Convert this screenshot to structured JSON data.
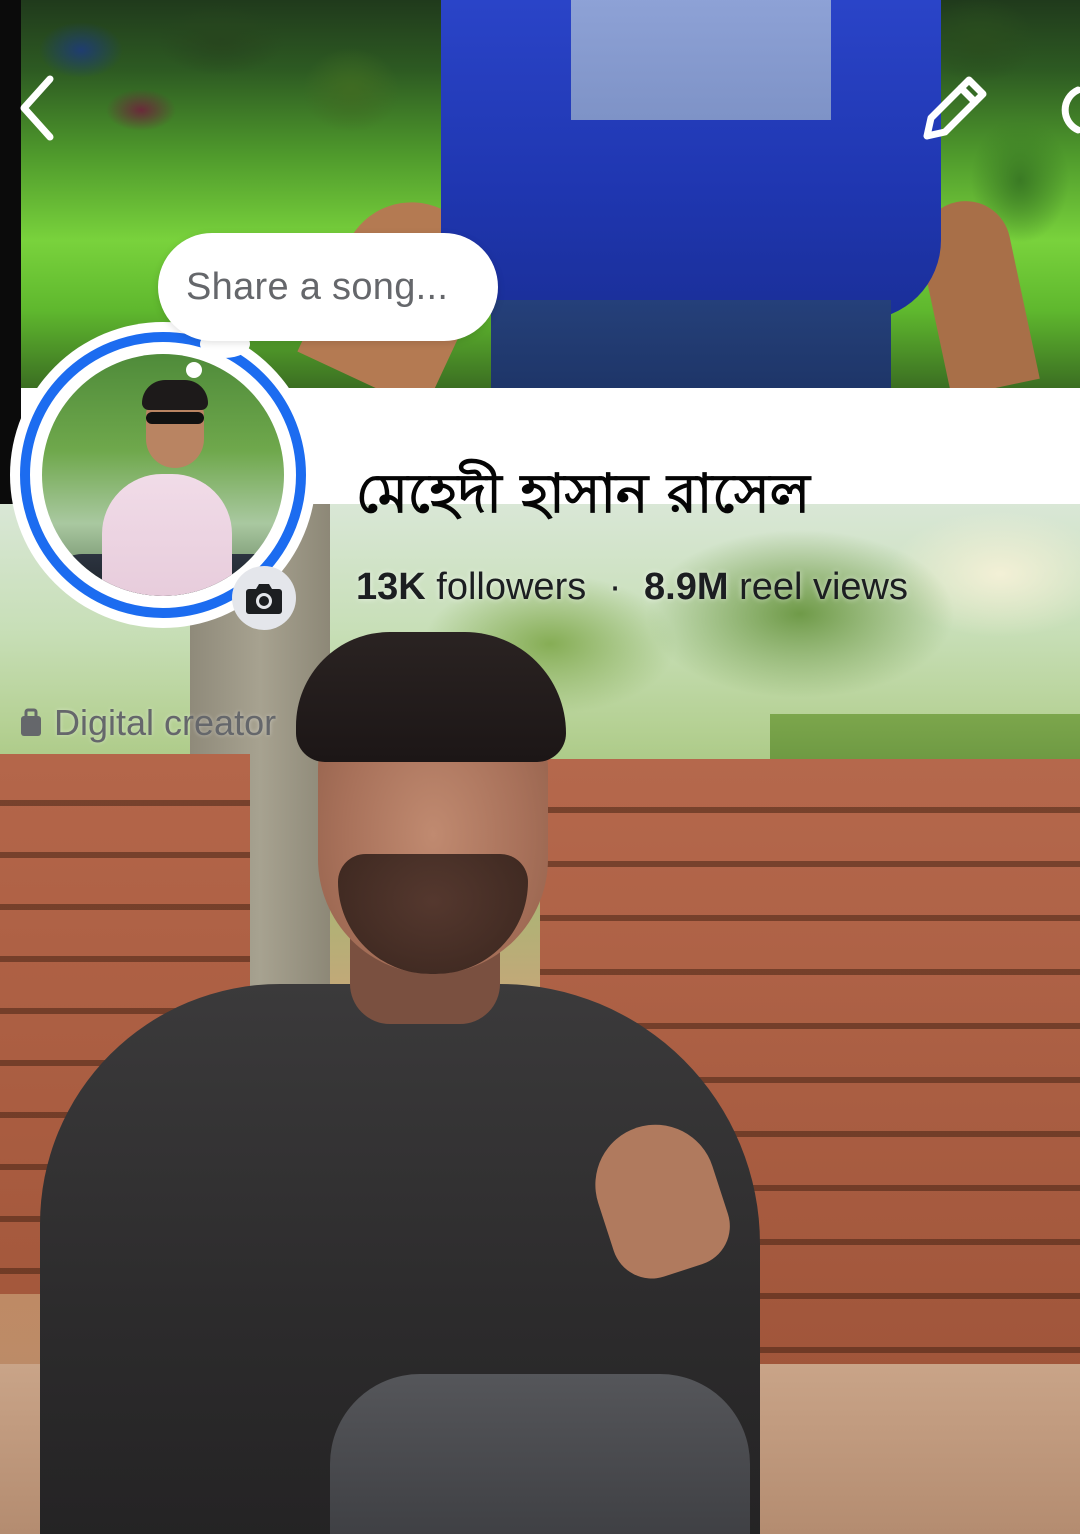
{
  "profile": {
    "name": "মেহেদী হাসান রাসেল",
    "followers_count": "13K",
    "followers_label": "followers",
    "separator": "·",
    "reel_views_count": "8.9M",
    "reel_views_label": "reel views",
    "category": "Digital creator"
  },
  "song_prompt": {
    "placeholder": "Share a song..."
  },
  "icons": {
    "back": "chevron-left-icon",
    "edit": "pencil-icon",
    "camera": "camera-icon",
    "category": "briefcase-icon"
  },
  "colors": {
    "story_ring": "#1c6cf0",
    "name_text": "#050505",
    "secondary_text": "#65676b"
  }
}
